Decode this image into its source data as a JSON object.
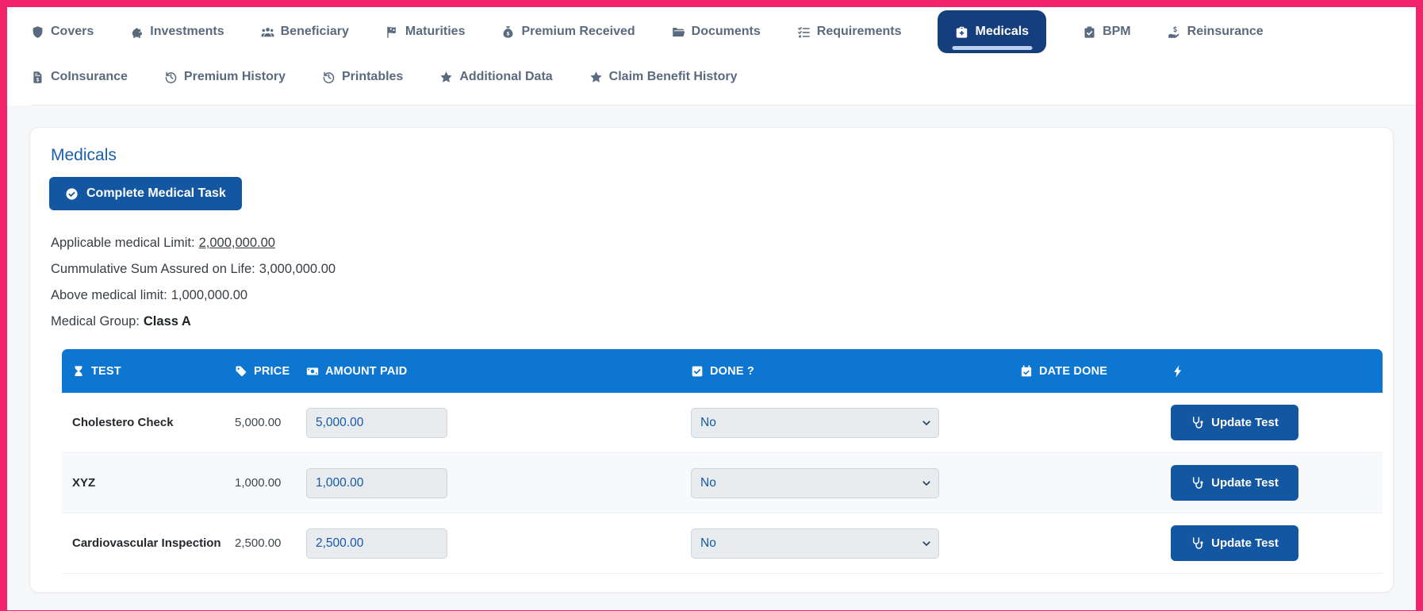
{
  "theme": {
    "frame_color": "#F1246C",
    "active_tab_bg": "#153E7C",
    "active_tab_underline": "#BACFEC",
    "button_bg": "#1356A2",
    "table_header_bg": "#0D76D1",
    "heading_blue": "#1B5FAB",
    "input_text_blue": "#1658A8"
  },
  "tabs": {
    "row1": [
      {
        "label": "Covers",
        "icon": "shield-icon"
      },
      {
        "label": "Investments",
        "icon": "piggy-bank-icon"
      },
      {
        "label": "Beneficiary",
        "icon": "users-icon"
      },
      {
        "label": "Maturities",
        "icon": "flag-checkered-icon"
      },
      {
        "label": "Premium Received",
        "icon": "money-bag-icon"
      },
      {
        "label": "Documents",
        "icon": "folder-open-icon"
      },
      {
        "label": "Requirements",
        "icon": "tasks-icon"
      },
      {
        "label": "Medicals",
        "icon": "medical-briefcase-icon",
        "active": true
      },
      {
        "label": "BPM",
        "icon": "clipboard-check-icon"
      },
      {
        "label": "Reinsurance",
        "icon": "hand-holding-dollar-icon"
      }
    ],
    "row2": [
      {
        "label": "CoInsurance",
        "icon": "file-invoice-dollar-icon"
      },
      {
        "label": "Premium History",
        "icon": "history-icon"
      },
      {
        "label": "Printables",
        "icon": "history-icon"
      },
      {
        "label": "Additional Data",
        "icon": "star-icon"
      },
      {
        "label": "Claim Benefit History",
        "icon": "star-icon"
      }
    ]
  },
  "panel": {
    "title": "Medicals",
    "complete_button_label": "Complete Medical Task",
    "info": [
      {
        "label": "Applicable medical Limit:",
        "value": "2,000,000.00"
      },
      {
        "label": "Cummulative Sum Assured on Life:",
        "value": "3,000,000.00"
      },
      {
        "label": "Above medical limit:",
        "value": "1,000,000.00"
      },
      {
        "label": "Medical Group:",
        "value": "Class A"
      }
    ]
  },
  "table": {
    "columns": [
      {
        "label": "TEST",
        "icon": "hourglass-icon"
      },
      {
        "label": "PRICE",
        "icon": "tag-icon"
      },
      {
        "label": "AMOUNT PAID",
        "icon": "money-bill-icon"
      },
      {
        "label": "DONE ?",
        "icon": "check-square-icon"
      },
      {
        "label": "DATE DONE",
        "icon": "calendar-check-icon"
      },
      {
        "label": "",
        "icon": "bolt-icon"
      }
    ],
    "rows": [
      {
        "test": "Cholestero Check",
        "price": "5,000.00",
        "amount_paid": "5,000.00",
        "done": "No",
        "date_done": "",
        "action_label": "Update Test"
      },
      {
        "test": "XYZ",
        "price": "1,000.00",
        "amount_paid": "1,000.00",
        "done": "No",
        "date_done": "",
        "action_label": "Update Test"
      },
      {
        "test": "Cardiovascular Inspection",
        "price": "2,500.00",
        "amount_paid": "2,500.00",
        "done": "No",
        "date_done": "",
        "action_label": "Update Test"
      }
    ]
  }
}
